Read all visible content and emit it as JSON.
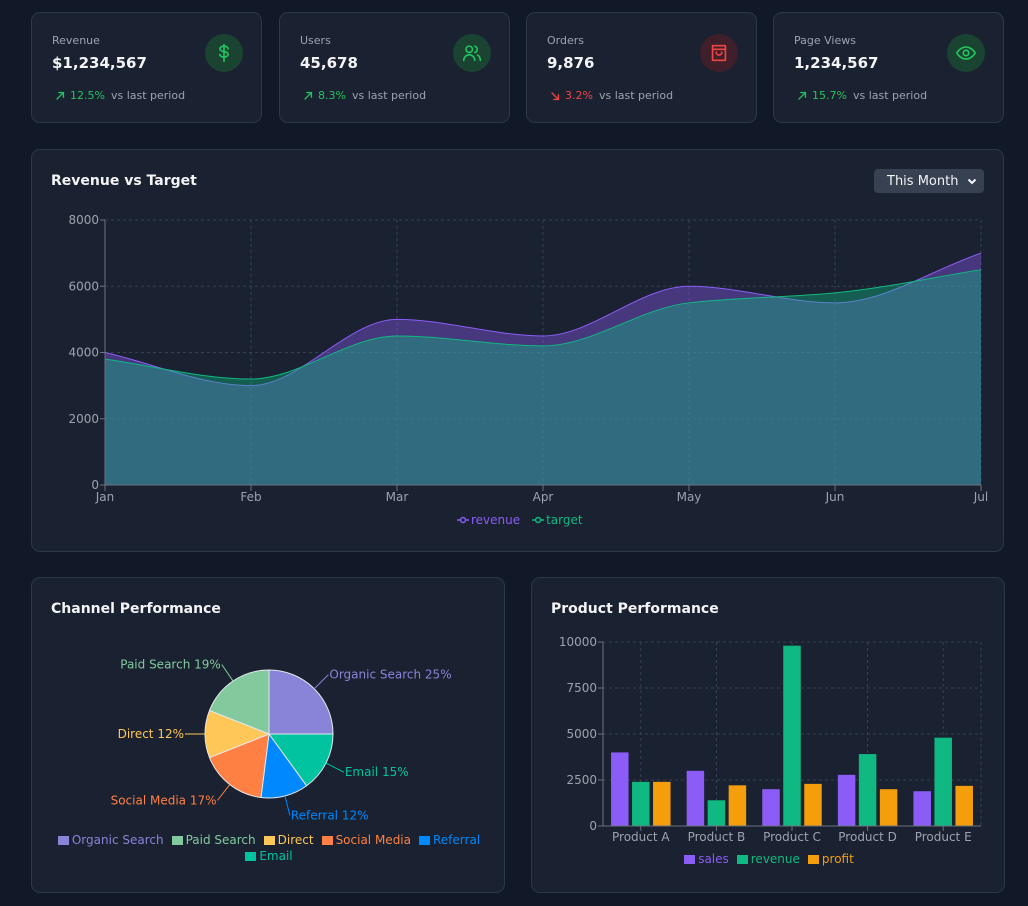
{
  "stats": [
    {
      "label": "Revenue",
      "value": "$1,234,567",
      "change": "12.5%",
      "direction": "up",
      "subtext": "vs last period",
      "icon": "dollar-icon",
      "color": "#22c55e",
      "icon_bg": "#1b4332"
    },
    {
      "label": "Users",
      "value": "45,678",
      "change": "8.3%",
      "direction": "up",
      "subtext": "vs last period",
      "icon": "users-icon",
      "color": "#22c55e",
      "icon_bg": "#1b4332"
    },
    {
      "label": "Orders",
      "value": "9,876",
      "change": "3.2%",
      "direction": "down",
      "subtext": "vs last period",
      "icon": "shopping-bag-icon",
      "color": "#ef4444",
      "icon_bg": "#3f1f2a"
    },
    {
      "label": "Page Views",
      "value": "1,234,567",
      "change": "15.7%",
      "direction": "up",
      "subtext": "vs last period",
      "icon": "eye-icon",
      "color": "#22c55e",
      "icon_bg": "#1b4332"
    }
  ],
  "revenue_panel": {
    "title": "Revenue vs Target",
    "period_select": {
      "value": "This Month"
    }
  },
  "channel_panel": {
    "title": "Channel Performance"
  },
  "product_panel": {
    "title": "Product Performance"
  },
  "chart_data": [
    {
      "type": "area",
      "title": "Revenue vs Target",
      "x": [
        "Jan",
        "Feb",
        "Mar",
        "Apr",
        "May",
        "Jun",
        "Jul"
      ],
      "series": [
        {
          "name": "revenue",
          "values": [
            4000,
            3000,
            5000,
            4500,
            6000,
            5500,
            7000
          ],
          "color": "#8b5cf6"
        },
        {
          "name": "target",
          "values": [
            3800,
            3200,
            4500,
            4200,
            5500,
            5800,
            6500
          ],
          "color": "#10b981"
        }
      ],
      "yticks": [
        0,
        2000,
        4000,
        6000,
        8000
      ],
      "ylim": [
        0,
        8000
      ],
      "grid": true,
      "legend": "bottom"
    },
    {
      "type": "pie",
      "title": "Channel Performance",
      "categories": [
        "Organic Search",
        "Paid Search",
        "Direct",
        "Social Media",
        "Referral",
        "Email"
      ],
      "values": [
        25,
        19,
        12,
        17,
        12,
        15
      ],
      "colors": [
        "#8884d8",
        "#82ca9d",
        "#ffc658",
        "#ff8042",
        "#0088fe",
        "#00c49f"
      ],
      "slice_order_clockwise_from_top": [
        "Organic Search",
        "Email",
        "Referral",
        "Social Media",
        "Direct",
        "Paid Search"
      ],
      "labels": [
        "Organic Search 25%",
        "Paid Search 19%",
        "Direct 12%",
        "Social Media 17%",
        "Referral 12%",
        "Email 15%"
      ],
      "legend": "bottom"
    },
    {
      "type": "bar",
      "title": "Product Performance",
      "categories": [
        "Product A",
        "Product B",
        "Product C",
        "Product D",
        "Product E"
      ],
      "series": [
        {
          "name": "sales",
          "values": [
            4000,
            3000,
            2000,
            2780,
            1890
          ],
          "color": "#8b5cf6"
        },
        {
          "name": "revenue",
          "values": [
            2400,
            1398,
            9800,
            3908,
            4800
          ],
          "color": "#10b981"
        },
        {
          "name": "profit",
          "values": [
            2400,
            2210,
            2290,
            2000,
            2181
          ],
          "color": "#f59e0b"
        }
      ],
      "yticks": [
        0,
        2500,
        5000,
        7500,
        10000
      ],
      "ylim": [
        0,
        10000
      ],
      "grid": true,
      "legend": "bottom"
    }
  ]
}
